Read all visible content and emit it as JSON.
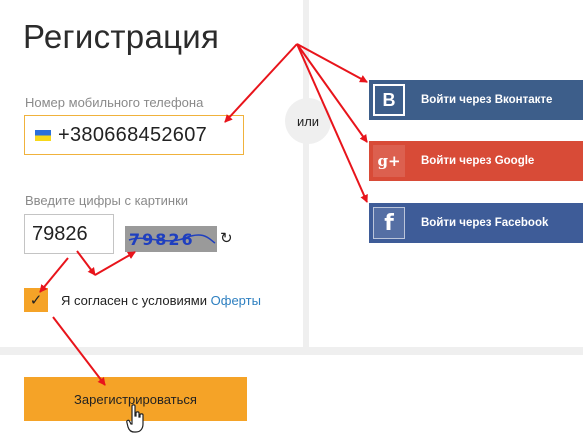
{
  "form": {
    "title": "Регистрация",
    "phone_label": "Номер мобильного телефона",
    "phone_value": "+380668452607",
    "captcha_label": "Введите цифры с картинки",
    "captcha_value": "79826",
    "captcha_image_text": "79826",
    "agree_text": "Я согласен с условиями",
    "agree_link": "Оферты",
    "checkbox_mark": "✓",
    "refresh_glyph": "↻"
  },
  "divider": {
    "or_text": "или"
  },
  "social": {
    "vk": {
      "label": "Войти через Вконтакте",
      "icon": "vk-icon",
      "glyph": "B",
      "color": "#3d5e8a"
    },
    "google": {
      "label": "Войти через Google",
      "icon": "google-plus-icon",
      "glyph": "g+",
      "color": "#d84b37"
    },
    "facebook": {
      "label": "Войти через Facebook",
      "icon": "facebook-icon",
      "glyph": "f",
      "color": "#3e5c98"
    }
  },
  "actions": {
    "register_label": "Зарегистрироваться",
    "register_color": "#f5a327"
  },
  "colors": {
    "annotation": "#e8141b",
    "link": "#2d7fc0",
    "background": "#efefef"
  }
}
